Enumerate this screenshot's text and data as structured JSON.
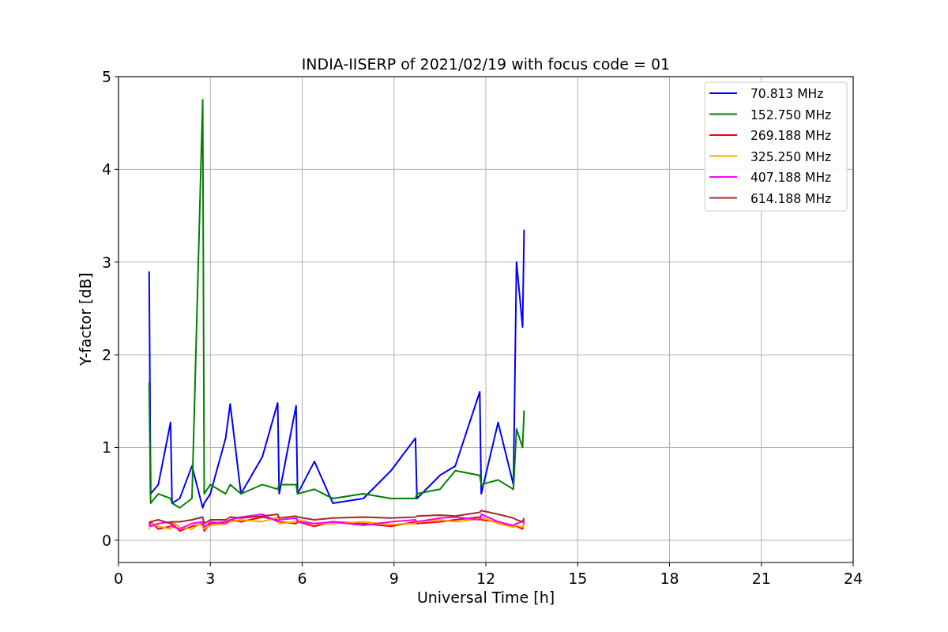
{
  "figure": {
    "chart_data": {
      "type": "line",
      "title": "INDIA-IISERP of 2021/02/19 with focus code = 01",
      "xlabel": "Universal Time [h]",
      "ylabel": "Y-factor [dB]",
      "x": [
        1.0,
        1.05,
        1.3,
        1.7,
        1.75,
        2.0,
        2.4,
        2.75,
        2.8,
        3.0,
        3.5,
        3.65,
        4.0,
        4.7,
        5.2,
        5.25,
        5.8,
        5.85,
        6.4,
        7.0,
        8.0,
        8.9,
        9.7,
        9.75,
        10.5,
        11.0,
        11.8,
        11.85,
        12.4,
        12.9,
        13.0,
        13.2,
        13.25
      ],
      "grid": true,
      "legend": true,
      "xlim": [
        0,
        24
      ],
      "ylim": [
        -0.24,
        5
      ],
      "xticks": [
        0,
        3,
        6,
        9,
        12,
        15,
        18,
        21,
        24
      ],
      "yticks": [
        0,
        1,
        2,
        3,
        4,
        5
      ],
      "series": [
        {
          "name": "70.813 MHz",
          "color": "#0000ff",
          "values": [
            2.9,
            0.5,
            0.6,
            1.27,
            0.4,
            0.45,
            0.8,
            0.35,
            0.4,
            0.5,
            1.1,
            1.47,
            0.5,
            0.9,
            1.48,
            0.5,
            1.45,
            0.5,
            0.85,
            0.4,
            0.45,
            0.75,
            1.1,
            0.45,
            0.7,
            0.8,
            1.6,
            0.5,
            1.27,
            0.6,
            3.0,
            2.3,
            3.35
          ]
        },
        {
          "name": "152.750 MHz",
          "color": "#008000",
          "values": [
            1.7,
            0.4,
            0.5,
            0.45,
            0.4,
            0.35,
            0.45,
            4.75,
            0.5,
            0.6,
            0.5,
            0.6,
            0.5,
            0.6,
            0.55,
            0.6,
            0.6,
            0.5,
            0.55,
            0.45,
            0.5,
            0.45,
            0.45,
            0.5,
            0.55,
            0.75,
            0.7,
            0.6,
            0.65,
            0.55,
            1.2,
            1.0,
            1.4
          ]
        },
        {
          "name": "269.188 MHz",
          "color": "#ff0000",
          "values": [
            0.15,
            0.2,
            0.12,
            0.15,
            0.18,
            0.1,
            0.15,
            0.18,
            0.1,
            0.18,
            0.2,
            0.22,
            0.2,
            0.25,
            0.22,
            0.2,
            0.18,
            0.2,
            0.15,
            0.2,
            0.18,
            0.15,
            0.2,
            0.18,
            0.2,
            0.22,
            0.25,
            0.22,
            0.2,
            0.15,
            0.15,
            0.12,
            0.2
          ]
        },
        {
          "name": "325.250 MHz",
          "color": "#ffa500",
          "values": [
            0.12,
            0.18,
            0.15,
            0.12,
            0.2,
            0.14,
            0.12,
            0.2,
            0.12,
            0.16,
            0.18,
            0.2,
            0.22,
            0.2,
            0.25,
            0.18,
            0.2,
            0.22,
            0.18,
            0.18,
            0.2,
            0.17,
            0.18,
            0.2,
            0.22,
            0.2,
            0.23,
            0.25,
            0.18,
            0.14,
            0.16,
            0.14,
            0.18
          ]
        },
        {
          "name": "407.188 MHz",
          "color": "#ff00ff",
          "values": [
            0.2,
            0.15,
            0.18,
            0.2,
            0.15,
            0.12,
            0.18,
            0.2,
            0.14,
            0.2,
            0.18,
            0.22,
            0.25,
            0.28,
            0.2,
            0.22,
            0.24,
            0.2,
            0.18,
            0.2,
            0.16,
            0.2,
            0.22,
            0.2,
            0.24,
            0.25,
            0.22,
            0.28,
            0.2,
            0.16,
            0.18,
            0.2,
            0.22
          ]
        },
        {
          "name": "614.188 MHz",
          "color": "#a52a2a",
          "values": [
            0.18,
            0.2,
            0.22,
            0.18,
            0.2,
            0.2,
            0.22,
            0.25,
            0.18,
            0.22,
            0.22,
            0.25,
            0.24,
            0.26,
            0.28,
            0.24,
            0.26,
            0.25,
            0.22,
            0.24,
            0.25,
            0.24,
            0.25,
            0.26,
            0.27,
            0.26,
            0.3,
            0.32,
            0.28,
            0.24,
            0.22,
            0.2,
            0.24
          ]
        }
      ]
    }
  }
}
